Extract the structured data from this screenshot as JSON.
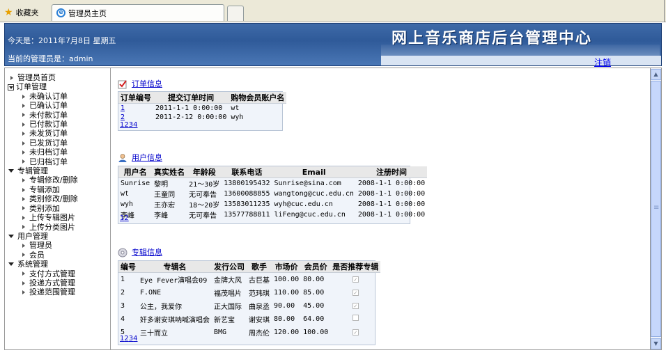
{
  "browser": {
    "favorites_label": "收藏夹",
    "tab_title": "管理员主页"
  },
  "header": {
    "date_text": "今天是：2011年7月8日 星期五",
    "admin_text": "当前的管理员是：admin",
    "site_title": "网上音乐商店后台管理中心",
    "logout_label": "注销"
  },
  "sidebar": {
    "home": "管理员首页",
    "groups": [
      {
        "label": "订单管理",
        "items": [
          "未确认订单",
          "已确认订单",
          "未付款订单",
          "已付款订单",
          "未发货订单",
          "已发货订单",
          "未归档订单",
          "已归档订单"
        ]
      },
      {
        "label": "专辑管理",
        "items": [
          "专辑修改/删除",
          "专辑添加",
          "类别修改/删除",
          "类别添加",
          "上传专辑图片",
          "上传分类图片"
        ]
      },
      {
        "label": "用户管理",
        "items": [
          "管理员",
          "会员"
        ]
      },
      {
        "label": "系统管理",
        "items": [
          "支付方式管理",
          "投递方式管理",
          "投递范围管理"
        ]
      }
    ]
  },
  "orders": {
    "title": "订单信息",
    "headers": [
      "订单编号",
      "提交订单时间",
      "购物会员账户名"
    ],
    "rows": [
      [
        "1",
        "2011-1-1 0:00:00",
        "wt"
      ],
      [
        "2",
        "2011-2-12 0:00:00",
        "wyh"
      ]
    ],
    "pages": [
      "1",
      "2",
      "3",
      "4"
    ]
  },
  "users": {
    "title": "用户信息",
    "headers": [
      "用户名",
      "真实姓名",
      "年龄段",
      "联系电话",
      "Email",
      "注册时间"
    ],
    "rows": [
      [
        "Sunrise",
        "黎明",
        "21～30岁",
        "13800195432",
        "Sunrise@sina.com",
        "2008-1-1 0:00:00"
      ],
      [
        "wt",
        "王童同",
        "无可奉告",
        "13600088855",
        "wangtong@cuc.edu.cn",
        "2008-1-1 0:00:00"
      ],
      [
        "wyh",
        "王亦宏",
        "18～20岁",
        "13583011235",
        "wyh@cuc.edu.cn",
        "2008-1-1 0:00:00"
      ],
      [
        "李峰",
        "李峰",
        "无可奉告",
        "13577788811",
        "liFeng@cuc.edu.cn",
        "2008-1-1 0:00:00"
      ]
    ],
    "pages": [
      "1",
      "2"
    ]
  },
  "albums": {
    "title": "专辑信息",
    "headers": [
      "编号",
      "专辑名",
      "发行公司",
      "歌手",
      "市场价",
      "会员价",
      "是否推荐专辑"
    ],
    "rows": [
      [
        "1",
        "Eye Fever演唱会09",
        "金牌大风",
        "古巨基",
        "100.00",
        "80.00"
      ],
      [
        "2",
        "F.ONE",
        "福茂唱片",
        "范玮琪",
        "110.00",
        "85.00"
      ],
      [
        "3",
        "公主，我爱你",
        "正大国际",
        "曲泉丞",
        "90.00",
        "45.00"
      ],
      [
        "4",
        "奸多谢安琪呐喊演唱会",
        "新艺宝",
        "谢安琪",
        "80.00",
        "64.00"
      ],
      [
        "5",
        "三十而立",
        "BMG",
        "周杰伦",
        "120.00",
        "100.00"
      ]
    ],
    "recommended": [
      true,
      true,
      true,
      false,
      true
    ],
    "pages": [
      "1",
      "2",
      "3",
      "4"
    ]
  },
  "colors": {
    "header_blue": "#2f5a99",
    "link": "#0000cc",
    "table_bg": "#f0f4fa"
  }
}
